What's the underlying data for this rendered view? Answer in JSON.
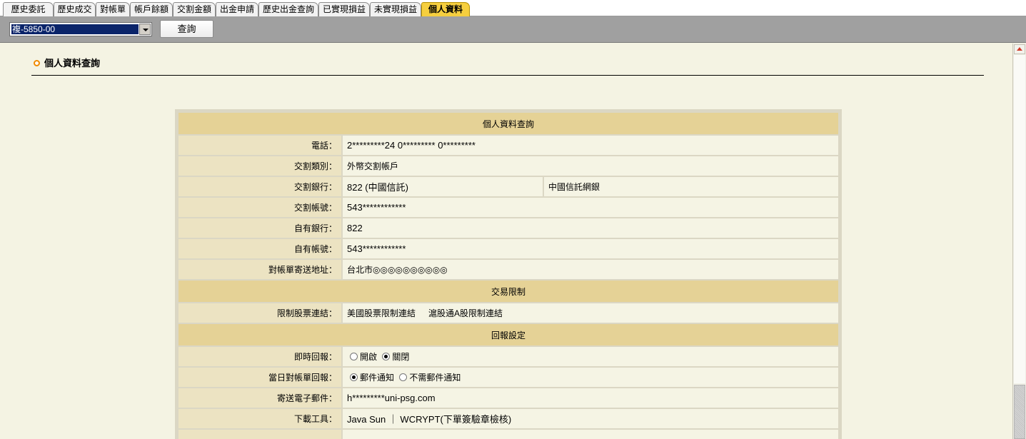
{
  "tabs": [
    {
      "label": "歷史委託",
      "active": false
    },
    {
      "label": "歷史成交",
      "active": false
    },
    {
      "label": "對帳單",
      "active": false
    },
    {
      "label": "帳戶餘額",
      "active": false
    },
    {
      "label": "交割金額",
      "active": false
    },
    {
      "label": "出金申請",
      "active": false
    },
    {
      "label": "歷史出金查詢",
      "active": false
    },
    {
      "label": "已實現損益",
      "active": false
    },
    {
      "label": "未實現損益",
      "active": false
    },
    {
      "label": "個人資料",
      "active": true
    }
  ],
  "toolbar": {
    "account_value": "複-5850-00",
    "query_label": "查詢"
  },
  "page": {
    "heading": "個人資料查詢"
  },
  "table": {
    "title": "個人資料查詢",
    "phone_label": "電話：",
    "phone_value": "2*********24 0********* 0*********",
    "settle_type_label": "交割類別：",
    "settle_type_value": "外幣交割帳戶",
    "settle_bank_label": "交割銀行：",
    "settle_bank_value": "822 (中國信託)",
    "settle_bank_extra": "中國信託網銀",
    "settle_account_label": "交割帳號：",
    "settle_account_value": "543************",
    "own_bank_label": "自有銀行：",
    "own_bank_value": "822",
    "own_account_label": "自有帳號：",
    "own_account_value": "543************",
    "address_label": "對帳單寄送地址：",
    "address_value": "台北市◎◎◎◎◎◎◎◎◎◎",
    "trade_limit_title": "交易限制",
    "limit_label": "限制股票連結：",
    "limit_link_us": "美國股票限制連結",
    "limit_link_a": "滬股通A股限制連結",
    "report_title": "回報設定",
    "realtime_label": "即時回報：",
    "realtime_on": "開啟",
    "realtime_off": "關閉",
    "realtime_selected": "關閉",
    "daily_label": "當日對帳單回報：",
    "daily_email": "郵件通知",
    "daily_none": "不需郵件通知",
    "daily_selected": "郵件通知",
    "email_label": "寄送電子郵件：",
    "email_value": "h*********uni-psg.com",
    "download_label": "下載工具：",
    "download_value": "Java Sun ｜ WCRYPT(下單簽驗章檢核)"
  },
  "colors": {
    "active_tab": "#f6cf3f",
    "section_header": "#e5d296",
    "label_cell": "#ece3c2",
    "page_bg": "#f4f3e3",
    "bullet": "#f08a00"
  }
}
